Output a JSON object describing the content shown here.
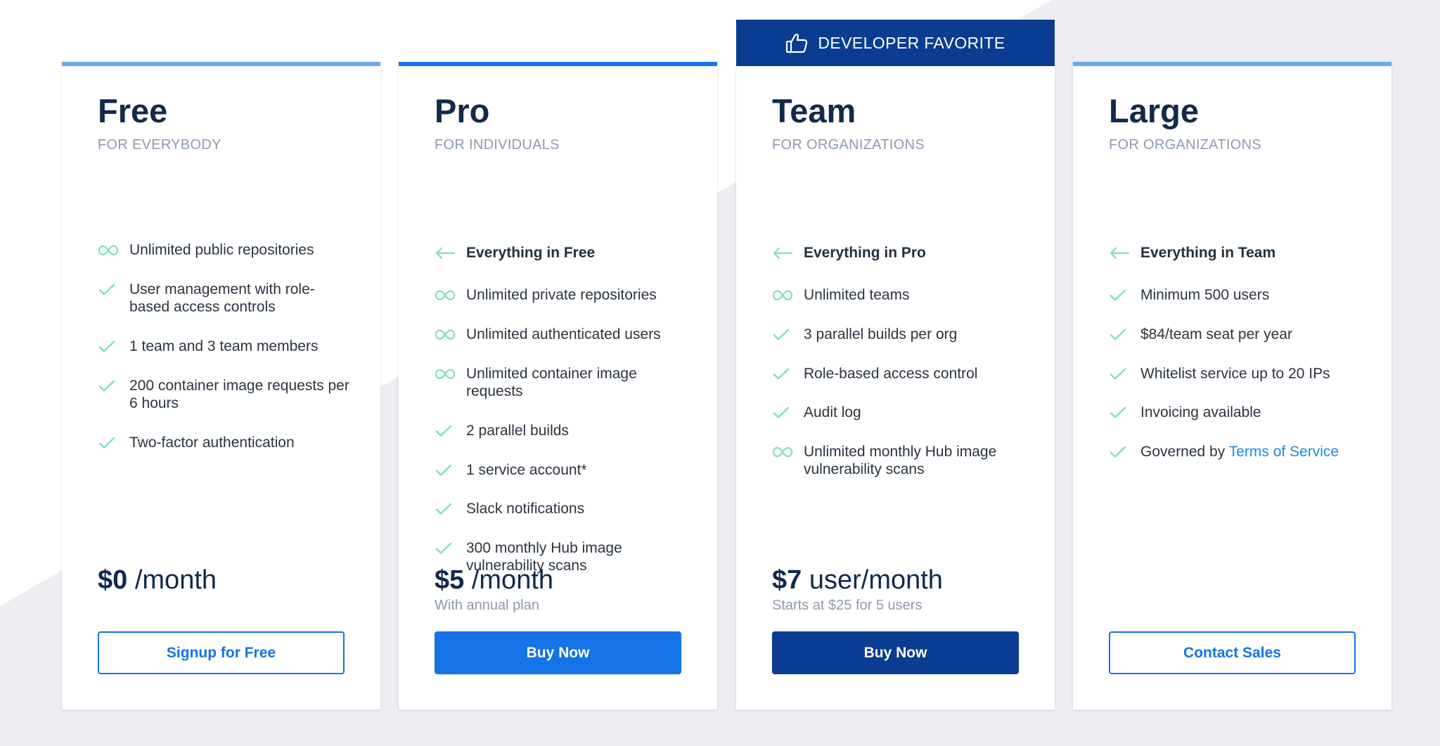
{
  "colors": {
    "navy": "#0a3d91",
    "blue": "#1473e6",
    "light_blue": "#69abf2",
    "mint_icon": "#7ddfc7",
    "heading": "#102a4c",
    "muted": "#8d9aae",
    "link": "#1a8dde",
    "background_gray": "#eceef1"
  },
  "banner": {
    "label": "DEVELOPER FAVORITE",
    "icon": "thumbs-up-icon"
  },
  "plans": [
    {
      "id": "free",
      "name": "Free",
      "audience": "FOR EVERYBODY",
      "stripe_color": "#69abf2",
      "features": [
        {
          "icon": "infinity-icon",
          "text": "Unlimited public repositories"
        },
        {
          "icon": "check-icon",
          "text": "User management with role-based access controls"
        },
        {
          "icon": "check-icon",
          "text": "1 team and 3 team members"
        },
        {
          "icon": "check-icon",
          "text": "200 container image requests per 6 hours"
        },
        {
          "icon": "check-icon",
          "text": "Two-factor authentication"
        }
      ],
      "price_amount": "$0",
      "price_unit": "/month",
      "price_note": "",
      "cta_label": "Signup for Free"
    },
    {
      "id": "pro",
      "name": "Pro",
      "audience": "FOR INDIVIDUALS",
      "stripe_color": "#1473e6",
      "features": [
        {
          "icon": "arrow-left-icon",
          "text": "Everything in Free"
        },
        {
          "icon": "infinity-icon",
          "text": "Unlimited private repositories"
        },
        {
          "icon": "infinity-icon",
          "text": "Unlimited authenticated users"
        },
        {
          "icon": "infinity-icon",
          "text": "Unlimited container image requests"
        },
        {
          "icon": "check-icon",
          "text": "2 parallel builds"
        },
        {
          "icon": "check-icon",
          "text": "1 service account*"
        },
        {
          "icon": "check-icon",
          "text": "Slack notifications"
        },
        {
          "icon": "check-icon",
          "text": "300 monthly Hub image vulnerability scans"
        }
      ],
      "price_amount": "$5",
      "price_unit": "/month",
      "price_note": "With annual plan",
      "cta_label": "Buy Now"
    },
    {
      "id": "team",
      "name": "Team",
      "audience": "FOR ORGANIZATIONS",
      "stripe_color": "#0a3d91",
      "features": [
        {
          "icon": "arrow-left-icon",
          "text": "Everything in Pro"
        },
        {
          "icon": "infinity-icon",
          "text": "Unlimited teams"
        },
        {
          "icon": "check-icon",
          "text": "3 parallel builds per org"
        },
        {
          "icon": "check-icon",
          "text": "Role-based access control"
        },
        {
          "icon": "check-icon",
          "text": "Audit log"
        },
        {
          "icon": "infinity-icon",
          "text": "Unlimited monthly Hub image vulnerability scans"
        }
      ],
      "price_amount": "$7",
      "price_unit": "user/month",
      "price_note": "Starts at $25 for 5 users",
      "cta_label": "Buy Now"
    },
    {
      "id": "large",
      "name": "Large",
      "audience": "FOR ORGANIZATIONS",
      "stripe_color": "#69abf2",
      "features": [
        {
          "icon": "arrow-left-icon",
          "text": "Everything in Team"
        },
        {
          "icon": "check-icon",
          "text": "Minimum 500 users"
        },
        {
          "icon": "check-icon",
          "text": "$84/team seat per year"
        },
        {
          "icon": "check-icon",
          "text": "Whitelist service up to 20 IPs"
        },
        {
          "icon": "check-icon",
          "text": "Invoicing available"
        },
        {
          "icon": "check-icon",
          "text": "Governed by ",
          "link": "Terms of Service"
        }
      ],
      "price_amount": "",
      "price_unit": "",
      "price_note": "",
      "cta_label": "Contact Sales"
    }
  ]
}
